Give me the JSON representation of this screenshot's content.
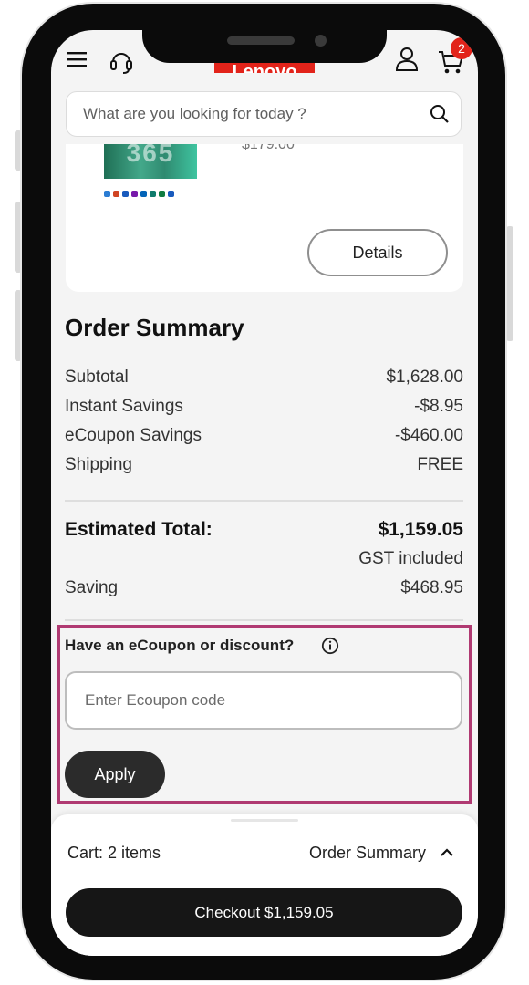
{
  "header": {
    "logo_text": "Lenovo",
    "cart_badge": "2",
    "icons": [
      "menu-icon",
      "headset-icon",
      "account-icon",
      "cart-icon"
    ]
  },
  "search": {
    "placeholder": "What are you looking for today ?"
  },
  "product_card": {
    "thumbnail_text": "365",
    "price_partial": "$179.00",
    "details_label": "Details"
  },
  "order_summary": {
    "title": "Order Summary",
    "rows": [
      {
        "label": "Subtotal",
        "value": "$1,628.00"
      },
      {
        "label": "Instant Savings",
        "value": "-$8.95"
      },
      {
        "label": "eCoupon Savings",
        "value": "-$460.00"
      },
      {
        "label": "Shipping",
        "value": "FREE"
      }
    ],
    "total_label": "Estimated Total:",
    "total_value": "$1,159.05",
    "tax_note": "GST included",
    "saving_label": "Saving",
    "saving_value": "$468.95"
  },
  "coupon": {
    "label": "Have an eCoupon or discount?",
    "placeholder": "Enter Ecoupon code",
    "apply_label": "Apply"
  },
  "bottom_bar": {
    "cart_text": "Cart: 2 items",
    "summary_toggle": "Order Summary",
    "checkout_label": "Checkout $1,159.05"
  },
  "colors": {
    "brand_red": "#e2231a",
    "highlight_border": "#b03a72",
    "button_dark": "#161616"
  }
}
